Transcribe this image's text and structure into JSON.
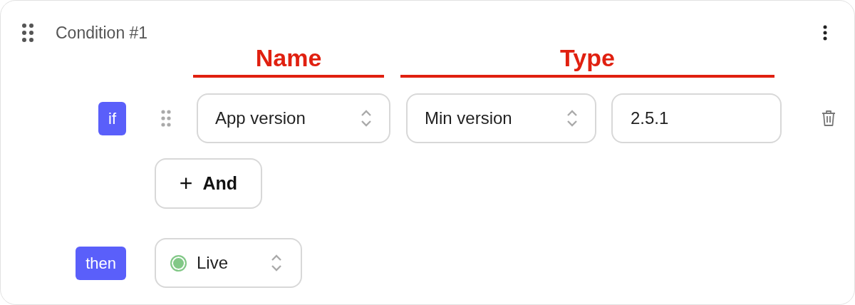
{
  "condition": {
    "title": "Condition #1"
  },
  "annotations": [
    {
      "label": "Name"
    },
    {
      "label": "Type"
    }
  ],
  "if_row": {
    "badge": "if",
    "name_select": {
      "value": "App version"
    },
    "type_select": {
      "value": "Min version"
    },
    "value_field": {
      "value": "2.5.1"
    }
  },
  "add_button": {
    "icon": "+",
    "label": "And"
  },
  "then_row": {
    "badge": "then",
    "status_select": {
      "value": "Live",
      "color": "#82c887"
    }
  }
}
